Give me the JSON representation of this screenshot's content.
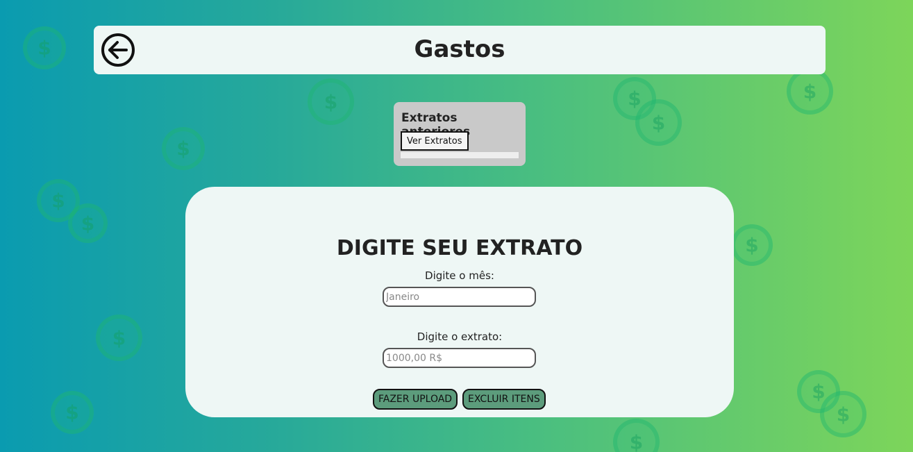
{
  "header": {
    "title": "Gastos",
    "back_icon": "arrow-left-circle-icon"
  },
  "extratos": {
    "title": "Extratos anteriores",
    "button_label": "Ver Extratos"
  },
  "form": {
    "title": "DIGITE SEU EXTRATO",
    "month_label": "Digite o mês:",
    "month_placeholder": "Janeiro",
    "month_value": "",
    "statement_label": "Digite o extrato:",
    "statement_placeholder": "1000,00 R$",
    "statement_value": "",
    "upload_button": "FAZER UPLOAD",
    "delete_button": "EXCLUIR ITENS"
  },
  "background": {
    "icon": "dollar-coin-icon"
  },
  "colors": {
    "gradient_start": "#0a9bb0",
    "gradient_end": "#7dd55a",
    "panel_background": "#eef7f5",
    "action_button": "#5c9c7c",
    "extratos_box": "#c9c9c9"
  }
}
